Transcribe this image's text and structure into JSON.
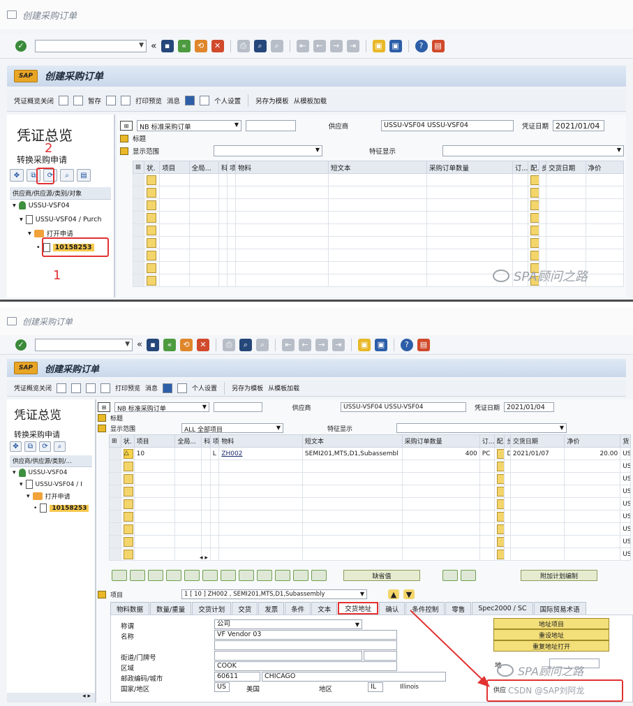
{
  "window_title": "创建采购订单",
  "app_title": "创建采购订单",
  "app_toolbar": [
    "凭证概览关闭",
    "暂存",
    "打印预览",
    "消息",
    "个人设置",
    "另存为模板",
    "从模板加载"
  ],
  "app_toolbar_p2": [
    "凭证概览关闭",
    "打印预览",
    "消息",
    "个人设置",
    "另存为模板",
    "从模板加载"
  ],
  "left": {
    "title": "凭证总览",
    "convert": "转换采购申请",
    "col_header": "供应商/供应源/类别/对象",
    "col_header_p2": "供应商/供应源/类别/...",
    "tree": [
      "USSU-VSF04",
      "USSU-VSF04 / Purch",
      "打开申请",
      "10158253"
    ],
    "tree_p2": [
      "USSU-VSF04",
      "USSU-VSF04 / I",
      "打开申请",
      "10158253"
    ]
  },
  "annotations": {
    "n1": "1",
    "n2": "2"
  },
  "header": {
    "doc_type": "NB 标准采购订单",
    "vendor_label": "供应商",
    "vendor_value": "USSU-VSF04 USSU-VSF04",
    "date_label": "凭证日期",
    "date_value": "2021/01/04",
    "section_header": "标题",
    "display_range_label": "显示范围",
    "display_range_value": "ALL 全部项目",
    "feature_label": "特征显示"
  },
  "grid_headers_p1": [
    "状.",
    "项目",
    "全局...",
    "科",
    "项.",
    "物料",
    "短文本",
    "采购订单数量",
    "订...",
    "配.",
    "步",
    "交货日期",
    "净价"
  ],
  "grid_headers_p2": [
    "状.",
    "项目",
    "全局...",
    "科",
    "项.",
    "物料",
    "短文本",
    "采购订单数量",
    "订...",
    "配.",
    "步",
    "交货日期",
    "净价",
    "货"
  ],
  "item_row": {
    "item": "10",
    "acct": "L",
    "material": "ZH002",
    "short_text": "SEMI201,MTS,D1,Subassembl",
    "qty": "400",
    "unit": "PC",
    "date_cat": "D",
    "delivery_date": "2021/01/07",
    "net_price": "20.00",
    "curr": "US"
  },
  "watermark": "SPA顾问之路",
  "watermark_csdn": "CSDN @SAP刘阿龙",
  "item_section": {
    "label": "项目",
    "selector": "1 [ 10 ] ZH002 , SEMI201,MTS,D1,Subassembly",
    "default_btn": "缺省值",
    "additional_btn": "附加计划编制"
  },
  "tabs": [
    "物料数据",
    "数量/重量",
    "交货计划",
    "交货",
    "发票",
    "条件",
    "文本",
    "交货地址",
    "确认",
    "条件控制",
    "零售",
    "Spec2000 / SC",
    "国际贸易术语"
  ],
  "address": {
    "title_label": "称谓",
    "title_value": "公司",
    "name_label": "名称",
    "name_value": "VF Vendor 03",
    "street_label": "街道/门牌号",
    "region_label": "区域",
    "region_value": "COOK",
    "postal_label": "邮政编码/城市",
    "postal_value": "60611",
    "city_value": "CHICAGO",
    "country_label": "国家/地区",
    "country_value": "US",
    "country_text": "美国",
    "district_label": "地区",
    "district_value": "IL",
    "district_text": "Illinois",
    "btn_address_item": "地址项目",
    "btn_reset": "重设地址",
    "btn_reopen": "重复地址打开",
    "vendor_box_text": "供应",
    "box_prefix": "地"
  }
}
